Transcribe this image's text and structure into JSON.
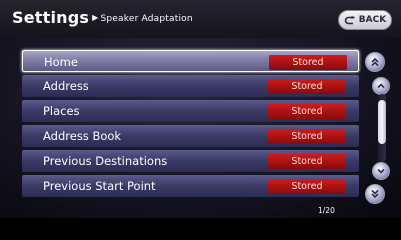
{
  "header": {
    "title": "Settings",
    "breadcrumb_sub": "Speaker Adaptation",
    "back_label": "BACK"
  },
  "list": {
    "selected_index": 0,
    "items": [
      {
        "label": "Home",
        "status": "Stored"
      },
      {
        "label": "Address",
        "status": "Stored"
      },
      {
        "label": "Places",
        "status": "Stored"
      },
      {
        "label": "Address Book",
        "status": "Stored"
      },
      {
        "label": "Previous Destinations",
        "status": "Stored"
      },
      {
        "label": "Previous Start Point",
        "status": "Stored"
      }
    ]
  },
  "pagination": {
    "indicator": "1/20"
  },
  "icons": {
    "back": "u-turn-arrow-icon",
    "page_up": "double-chevron-up-icon",
    "line_up": "chevron-up-icon",
    "line_down": "chevron-down-icon",
    "page_down": "double-chevron-down-icon"
  },
  "colors": {
    "status_bg": "#b01414",
    "row_bg": "#3a3a66",
    "selected_row_bg": "#8a87ae",
    "screen_bg": "#141320"
  }
}
